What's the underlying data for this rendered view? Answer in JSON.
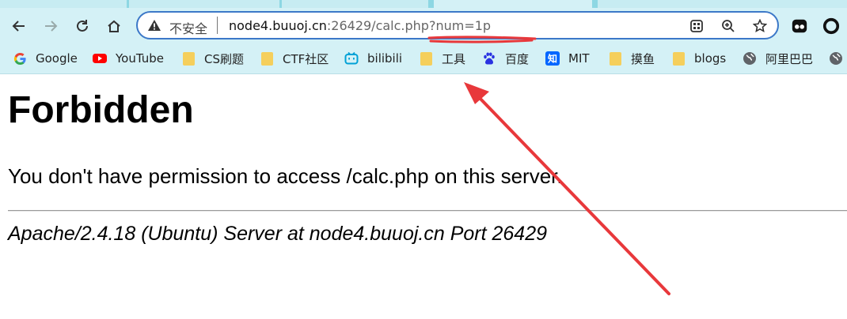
{
  "browser": {
    "omnibox": {
      "security_label": "不安全",
      "url_host": "node4.buuoj.cn",
      "url_rest": ":26429/calc.php?num=1p"
    },
    "bookmarks": [
      {
        "label": "Google",
        "icon": "google-icon"
      },
      {
        "label": "YouTube",
        "icon": "youtube-icon"
      },
      {
        "label": "CS刷题",
        "icon": "folder-icon"
      },
      {
        "label": "CTF社区",
        "icon": "folder-icon"
      },
      {
        "label": "bilibili",
        "icon": "bilibili-icon"
      },
      {
        "label": "工具",
        "icon": "folder-icon"
      },
      {
        "label": "百度",
        "icon": "baidu-icon"
      },
      {
        "label": "MIT",
        "icon": "zhihu-icon"
      },
      {
        "label": "摸鱼",
        "icon": "folder-icon"
      },
      {
        "label": "blogs",
        "icon": "folder-icon"
      },
      {
        "label": "阿里巴巴",
        "icon": "globe-icon"
      }
    ]
  },
  "page": {
    "title": "Forbidden",
    "message": "You don't have permission to access /calc.php on this server.",
    "server_signature": "Apache/2.4.18 (Ubuntu) Server at node4.buuoj.cn Port 26429"
  },
  "colors": {
    "toolbar_bg": "#d4f1f6",
    "omnibox_border": "#3c78c8",
    "annotation_red": "#e8383b",
    "folder": "#f5cf5c"
  }
}
